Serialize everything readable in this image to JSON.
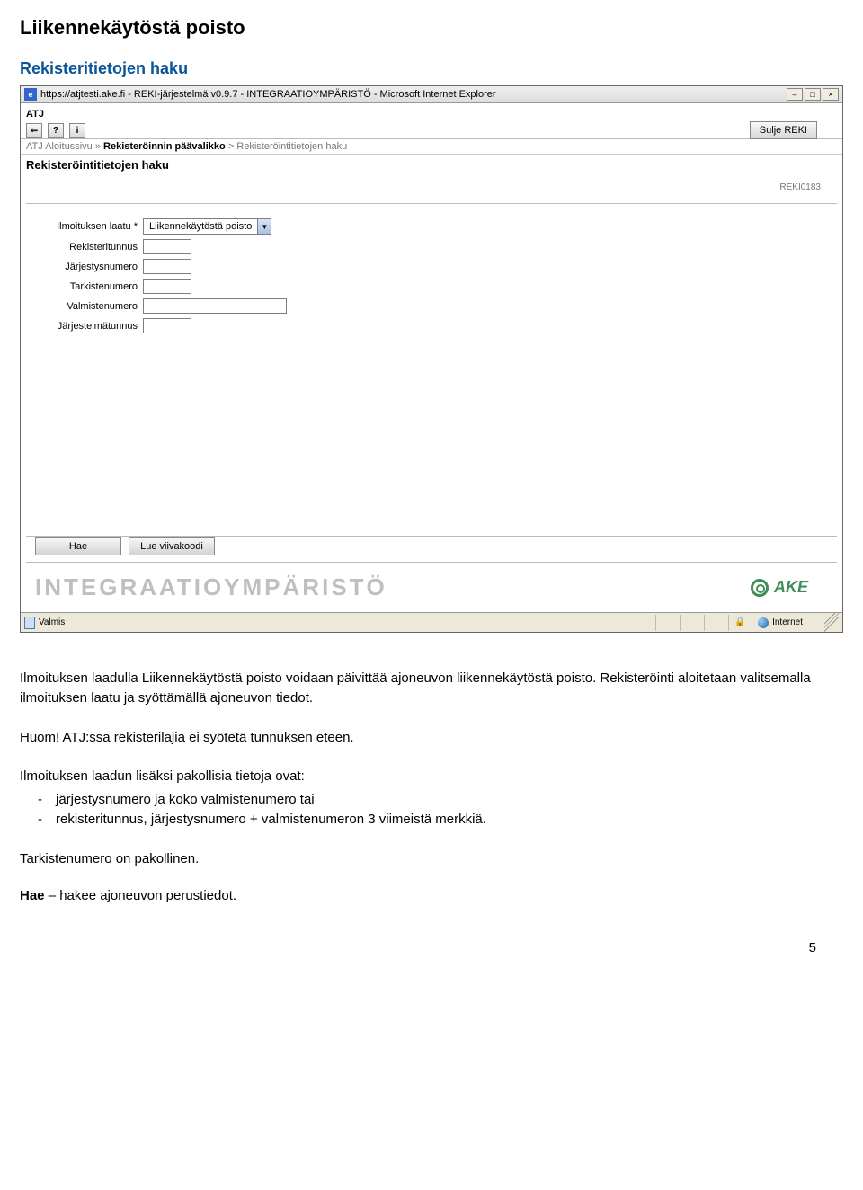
{
  "doc": {
    "heading1": "Liikennekäytöstä poisto",
    "heading2": "Rekisteritietojen haku",
    "para1": "Ilmoituksen laadulla Liikennekäytöstä poisto voidaan päivittää ajoneuvon liikennekäytöstä poisto. Rekisteröinti aloitetaan valitsemalla ilmoituksen laatu ja syöttämällä ajoneuvon tiedot.",
    "huom": "Huom! ATJ:ssa rekisterilajia ei syötetä tunnuksen eteen.",
    "list_intro": "Ilmoituksen laadun lisäksi pakollisia tietoja ovat:",
    "list_items": [
      "järjestysnumero ja koko valmistenumero tai",
      "rekisteritunnus, järjestysnumero + valmistenumeron 3 viimeistä merkkiä."
    ],
    "tarkiste": "Tarkistenumero on pakollinen.",
    "hae_line_bold": "Hae",
    "hae_line_rest": " – hakee ajoneuvon perustiedot.",
    "page_number": "5"
  },
  "ie": {
    "title": "https://atjtesti.ake.fi - REKI-järjestelmä v0.9.7 - INTEGRAATIOYMPÄRISTÖ - Microsoft Internet Explorer",
    "status": "Valmis",
    "zone": "Internet"
  },
  "app": {
    "top_label": "ATJ",
    "sulje": "Sulje REKI",
    "crumb1": "ATJ Aloitussivu",
    "crumb2": "Rekisteröinnin päävalikko",
    "crumb3": "Rekisteröintitietojen haku",
    "page_title": "Rekisteröintitietojen haku",
    "page_code": "REKI0183",
    "form": {
      "ilmoituksen_laatu_label": "Ilmoituksen laatu *",
      "ilmoituksen_laatu_value": "Liikennekäytöstä poisto",
      "rekisteritunnus": "Rekisteritunnus",
      "jarjestysnumero": "Järjestysnumero",
      "tarkistenumero": "Tarkistenumero",
      "valmistenumero": "Valmistenumero",
      "jarjestelmatunnus": "Järjestelmätunnus"
    },
    "btn_hae": "Hae",
    "btn_lue": "Lue viivakoodi",
    "watermark": "INTEGRAATIOYMPÄRISTÖ",
    "ake": "AKE"
  }
}
